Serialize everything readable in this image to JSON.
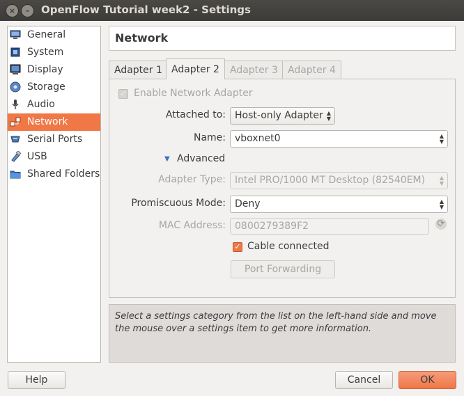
{
  "window": {
    "title": "OpenFlow Tutorial week2 - Settings",
    "close_glyph": "×",
    "minimize_glyph": "–"
  },
  "sidebar": {
    "items": [
      {
        "label": "General",
        "icon": "monitor-icon"
      },
      {
        "label": "System",
        "icon": "chip-icon"
      },
      {
        "label": "Display",
        "icon": "display-icon"
      },
      {
        "label": "Storage",
        "icon": "disk-icon"
      },
      {
        "label": "Audio",
        "icon": "microphone-icon"
      },
      {
        "label": "Network",
        "icon": "network-icon",
        "selected": true
      },
      {
        "label": "Serial Ports",
        "icon": "serial-port-icon"
      },
      {
        "label": "USB",
        "icon": "usb-icon"
      },
      {
        "label": "Shared Folders",
        "icon": "folder-icon"
      }
    ]
  },
  "page": {
    "title": "Network"
  },
  "tabs": [
    {
      "label": "Adapter 1",
      "state": "normal"
    },
    {
      "label": "Adapter 2",
      "state": "active"
    },
    {
      "label": "Adapter 3",
      "state": "disabled"
    },
    {
      "label": "Adapter 4",
      "state": "disabled"
    }
  ],
  "form": {
    "enable_adapter": {
      "label": "Enable Network Adapter",
      "checked": true,
      "disabled": true
    },
    "attached_to": {
      "label": "Attached to:",
      "value": "Host-only Adapter"
    },
    "name": {
      "label": "Name:",
      "value": "vboxnet0"
    },
    "advanced": {
      "label": "Advanced",
      "expanded": true
    },
    "adapter_type": {
      "label": "Adapter Type:",
      "value": "Intel PRO/1000 MT Desktop (82540EM)",
      "disabled": true
    },
    "promiscuous_mode": {
      "label": "Promiscuous Mode:",
      "value": "Deny"
    },
    "mac_address": {
      "label": "MAC Address:",
      "value": "0800279389F2",
      "disabled": true
    },
    "cable_connected": {
      "label": "Cable connected",
      "checked": true
    },
    "port_forwarding": {
      "label": "Port Forwarding",
      "disabled": true
    }
  },
  "info": {
    "text": "Select a settings category from the list on the left-hand side and move the mouse over a settings item to get more information."
  },
  "footer": {
    "help_label": "Help",
    "cancel_label": "Cancel",
    "ok_label": "OK"
  },
  "glyphs": {
    "checkmark": "✓",
    "triangle_down": "▼",
    "updown": "▲▼",
    "refresh": "⟳"
  },
  "colors": {
    "accent": "#f07746",
    "titlebar": "#3c3b37",
    "panel_bg": "#f2f1f0"
  }
}
